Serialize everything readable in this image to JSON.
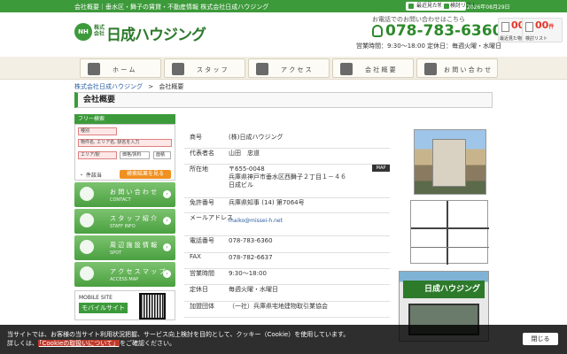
{
  "topbar": {
    "tagline": "会社概要｜垂水区・舞子の賃貸・不動産情報 株式会社日成ハウジング",
    "recent_label": "最近見た物件",
    "list_label": "検討リスト",
    "date": "2026年08月29日"
  },
  "header": {
    "logo_mark": "NH",
    "logo_small": "株式会社",
    "logo_name": "日成ハウジング",
    "contact_caption": "お電話でのお問い合わせはこちら",
    "phone": "078-783-6360",
    "hours": "営業時間：9:30〜18:00 定休日：毎週火曜・水曜日",
    "counters": [
      {
        "num": "00",
        "unit": "件",
        "label": "最近見た物件"
      },
      {
        "num": "00",
        "unit": "件",
        "label": "検討リスト"
      }
    ]
  },
  "nav": {
    "items": [
      {
        "label": "ホ ー ム",
        "icon": "home-icon"
      },
      {
        "label": "ス タ ッ フ",
        "icon": "staff-icon"
      },
      {
        "label": "ア ク セ ス",
        "icon": "map-icon"
      },
      {
        "label": "会 社 概 要",
        "icon": "building-icon"
      },
      {
        "label": "お 問 い 合 わ せ",
        "icon": "mail-icon"
      }
    ]
  },
  "breadcrumb": {
    "home": "株式会社日成ハウジング",
    "sep": ">",
    "current": "会社概要"
  },
  "page_title": "会社概要",
  "sidebar": {
    "search_head": "フリー検索",
    "type_select": "種別",
    "keyword_placeholder": "物件名, エリア名, 駅名を入力",
    "area_select": "エリア/駅",
    "price_select": "価格/賃料",
    "size_select": "面積",
    "tokuten": "・ 件該当",
    "search_button": "検索結果を見る",
    "menu": [
      {
        "title": "お 問 い 合 わ せ",
        "en": "CONTACT",
        "icon": "mail-icon"
      },
      {
        "title": "ス タ ッ フ 紹 介",
        "en": "STAFF INFO",
        "icon": "staff-icon"
      },
      {
        "title": "周 辺 施 設 情 報",
        "en": "SPOT",
        "icon": "spot-icon"
      },
      {
        "title": "ア ク セ ス マ ッ プ",
        "en": "ACCESS MAP",
        "icon": "map-icon"
      }
    ],
    "mobile_label": "MOBILE SITE",
    "mobile_button": "モバイルサイト"
  },
  "company": {
    "rows": [
      {
        "k": "商号",
        "v": "(株)日成ハウジング"
      },
      {
        "k": "代表者名",
        "v": "山田　忠道"
      },
      {
        "k": "所在地",
        "v": "〒655-0048",
        "v2": "兵庫県神戸市垂水区西舞子２丁目１－４６",
        "v3": "日成ビル"
      },
      {
        "k": "免許番号",
        "v": "兵庫県知事 (14) 第7064号"
      },
      {
        "k": "メールアドレス",
        "v": "maiko@missei-h.net"
      },
      {
        "k": "電話番号",
        "v": "078-783-6360"
      },
      {
        "k": "FAX",
        "v": "078-782-6637"
      },
      {
        "k": "営業時間",
        "v": "9:30〜18:00"
      },
      {
        "k": "定休日",
        "v": "毎週火曜・水曜日"
      },
      {
        "k": "加盟団体",
        "v": "（一社）兵庫県宅地建物取引業協会"
      }
    ],
    "map_button": "MAP"
  },
  "photos": {
    "sign_text": "日成ハウジング",
    "caption": "画像をクリックして拡大表示"
  },
  "cookie": {
    "line1": "当サイトでは、お客様の当サイト利用状況把握、サービス向上検討を目的として、クッキー（Cookie）を使用しています。",
    "line2_prefix": "詳しくは、",
    "line2_link": "「Cookieの取扱いについて」",
    "line2_suffix": "をご確認ください。",
    "close": "閉じる"
  }
}
